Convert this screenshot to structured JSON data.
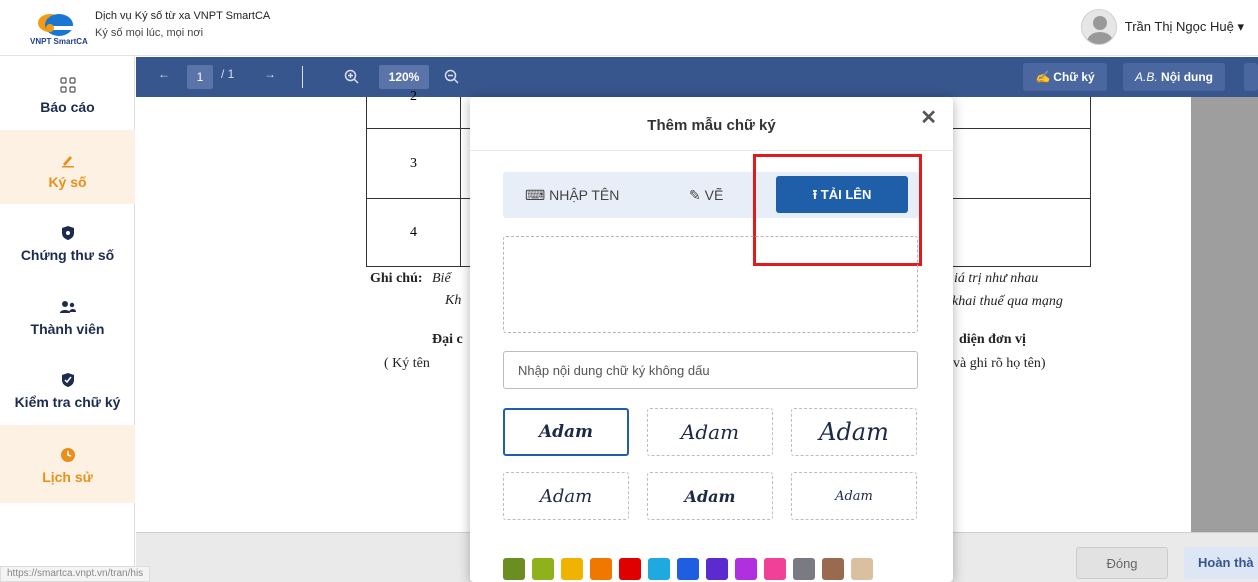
{
  "header": {
    "logo_text": "VNPT SmartCA",
    "title": "Dịch vụ Ký số từ xa VNPT SmartCA",
    "subtitle": "Ký số mọi lúc, mọi nơi",
    "user_name": "Trần Thị Ngọc Huệ ▾"
  },
  "sidebar": {
    "items": [
      {
        "label": "Báo cáo",
        "icon": "grid-icon"
      },
      {
        "label": "Ký số",
        "icon": "pen-icon"
      },
      {
        "label": "Chứng thư số",
        "icon": "shield-icon"
      },
      {
        "label": "Thành viên",
        "icon": "users-icon"
      },
      {
        "label": "Kiểm tra chữ ký",
        "icon": "shield-check-icon"
      },
      {
        "label": "Lịch sử",
        "icon": "clock-icon"
      }
    ]
  },
  "toolbar": {
    "prev": "←",
    "page": "1",
    "page_total": "/ 1",
    "next": "→",
    "zoom": "120%",
    "signature_label": "Chữ ký",
    "content_label": "Nội dung",
    "content_prefix": "A.B."
  },
  "document": {
    "rows": [
      "2",
      "3",
      "4"
    ],
    "note_label": "Ghi chú:",
    "note_1a": "Biể",
    "note_1b": "iá trị như nhau",
    "note_2a": "Kh",
    "note_2b": "khai thuế qua mạng",
    "rep_left": "Đại c",
    "rep_right": "diện đơn vị",
    "sign_left": "( Ký tên",
    "sign_right": "và ghi rõ họ tên)"
  },
  "footer": {
    "close_label": "Đóng",
    "done_label": "Hoàn thà",
    "status_url": "https://smartca.vnpt.vn/tran/his"
  },
  "modal": {
    "title": "Thêm mẫu chữ ký",
    "close": "✕",
    "tabs": {
      "type_name": "⌨ NHẬP TÊN",
      "draw": "✎ VẼ",
      "upload": "⭱ TẢI LÊN"
    },
    "input_placeholder": "Nhập nội dung chữ ký không dấu",
    "signatures": [
      "Adam",
      "Adam",
      "Adam",
      "Adam",
      "Adam",
      "Adam"
    ],
    "colors": [
      "#6b8e23",
      "#8fb21c",
      "#f0b400",
      "#f07800",
      "#e00000",
      "#1eaadf",
      "#1f5ee0",
      "#5b2bd0",
      "#b030e0",
      "#f04098",
      "#7a7a85",
      "#9a6a50",
      "#d8c0a0"
    ]
  }
}
